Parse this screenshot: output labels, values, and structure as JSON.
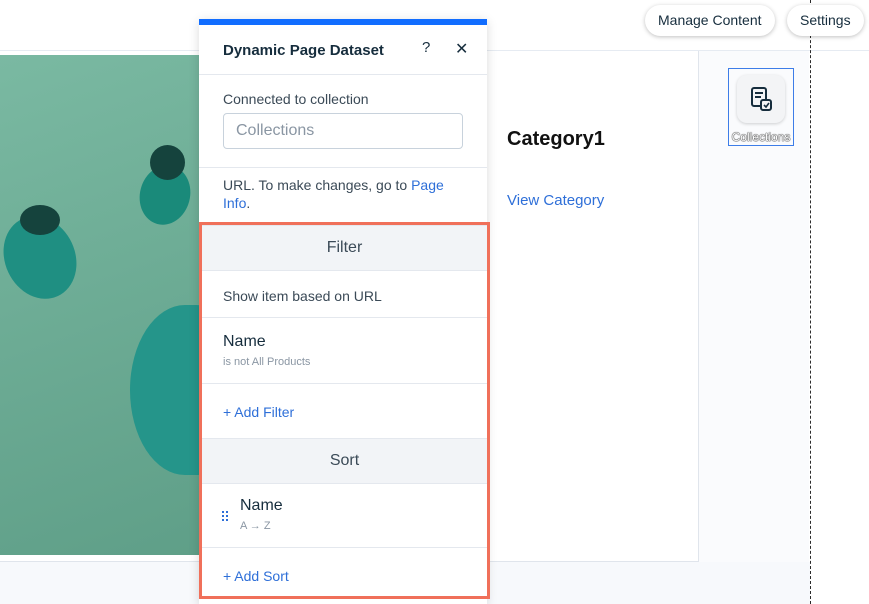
{
  "topbar": {
    "manage_content_label": "Manage Content",
    "settings_label": "Settings"
  },
  "page": {
    "category_title": "Category1",
    "view_category_link": "View Category"
  },
  "collections_widget": {
    "label": "Collections",
    "icon": "collection-document-icon"
  },
  "dataset_panel": {
    "title": "Dynamic Page Dataset",
    "help_label": "?",
    "close_label": "✕",
    "connected_label": "Connected to collection",
    "collection_placeholder": "Collections",
    "url_note": "URL. To make changes, go to ",
    "page_info_link": "Page Info",
    "url_note_end": ".",
    "filter": {
      "header": "Filter",
      "show_item_text": "Show item based on URL",
      "items": [
        {
          "name": "Name",
          "condition": "is not All Products"
        }
      ],
      "add_label": "+ Add Filter"
    },
    "sort": {
      "header": "Sort",
      "items": [
        {
          "name": "Name",
          "order": "A → Z"
        }
      ],
      "add_label": "+ Add Sort"
    }
  },
  "colors": {
    "accent": "#116dff",
    "link": "#2e6fd8",
    "highlight": "#f0705a"
  }
}
